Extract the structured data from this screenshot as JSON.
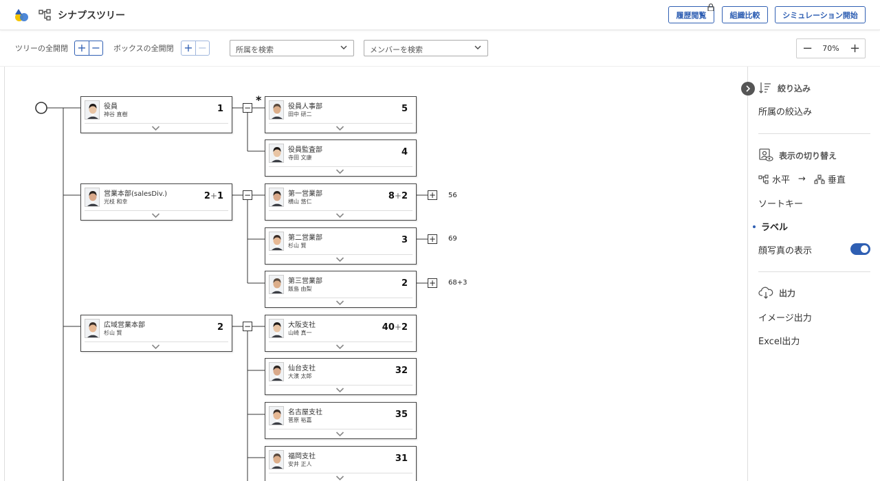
{
  "app": {
    "title": "シナプスツリー"
  },
  "header_buttons": {
    "history": "履歴閲覧",
    "compare": "組織比較",
    "simulation": "シミュレーション開始"
  },
  "toolbar": {
    "tree_toggle_label": "ツリーの全開閉",
    "box_toggle_label": "ボックスの全開閉",
    "dept_search_placeholder": "所属を検索",
    "member_search_placeholder": "メンバーを検索",
    "zoom": "70%",
    "plus": "+",
    "minus": "−"
  },
  "tree": {
    "level1": [
      {
        "name": "役員",
        "person": "神谷 直樹",
        "count": "1",
        "count_extra": ""
      },
      {
        "name": "営業本部(salesDiv.)",
        "person": "光枝 和幸",
        "count": "2",
        "count_extra": "1"
      },
      {
        "name": "広域営業本部",
        "person": "杉山 賢",
        "count": "2",
        "count_extra": ""
      }
    ],
    "level2": [
      {
        "name": "役員人事部",
        "person": "田中 研二",
        "count": "5",
        "count_extra": ""
      },
      {
        "name": "役員監査部",
        "person": "寺田 文康",
        "count": "4",
        "count_extra": ""
      },
      {
        "name": "第一営業部",
        "person": "横山 悠仁",
        "count": "8",
        "count_extra": "2"
      },
      {
        "name": "第二営業部",
        "person": "杉山 賢",
        "count": "3",
        "count_extra": ""
      },
      {
        "name": "第三営業部",
        "person": "飯島 由梨",
        "count": "2",
        "count_extra": ""
      },
      {
        "name": "大阪支社",
        "person": "山崎 真一",
        "count": "40",
        "count_extra": "2"
      },
      {
        "name": "仙台支社",
        "person": "大濱 太郎",
        "count": "32",
        "count_extra": ""
      },
      {
        "name": "名古屋支社",
        "person": "菅原 裕嘉",
        "count": "35",
        "count_extra": ""
      },
      {
        "name": "福岡支社",
        "person": "安井 正人",
        "count": "31",
        "count_extra": ""
      }
    ],
    "level3_counts": [
      "56",
      "69",
      "68+3"
    ],
    "marker": "*"
  },
  "panel": {
    "filter_title": "絞り込み",
    "filter_dept": "所属の絞込み",
    "display_title": "表示の切り替え",
    "horizontal": "水平",
    "arrow": "→",
    "vertical": "垂直",
    "sort_key": "ソートキー",
    "label": "ラベル",
    "face_photo": "顔写真の表示",
    "output_title": "出力",
    "image_output": "イメージ出力",
    "excel_output": "Excel出力"
  },
  "colors": {
    "accent": "#2f5fb3",
    "border": "#444444"
  }
}
